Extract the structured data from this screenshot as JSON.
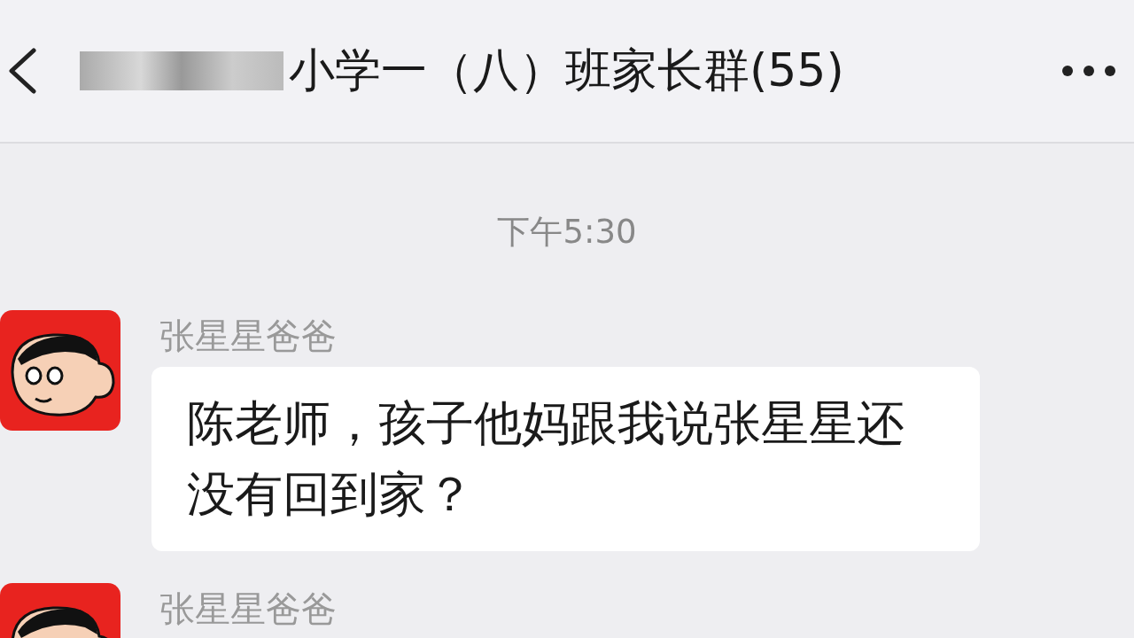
{
  "header": {
    "title": "小学一（八）班家长群(55)",
    "redacted": true
  },
  "timestamp": "下午5:30",
  "messages": [
    {
      "sender": "张星星爸爸",
      "text": "陈老师，孩子他妈跟我说张星星还没有回到家？"
    },
    {
      "sender": "张星星爸爸"
    }
  ]
}
